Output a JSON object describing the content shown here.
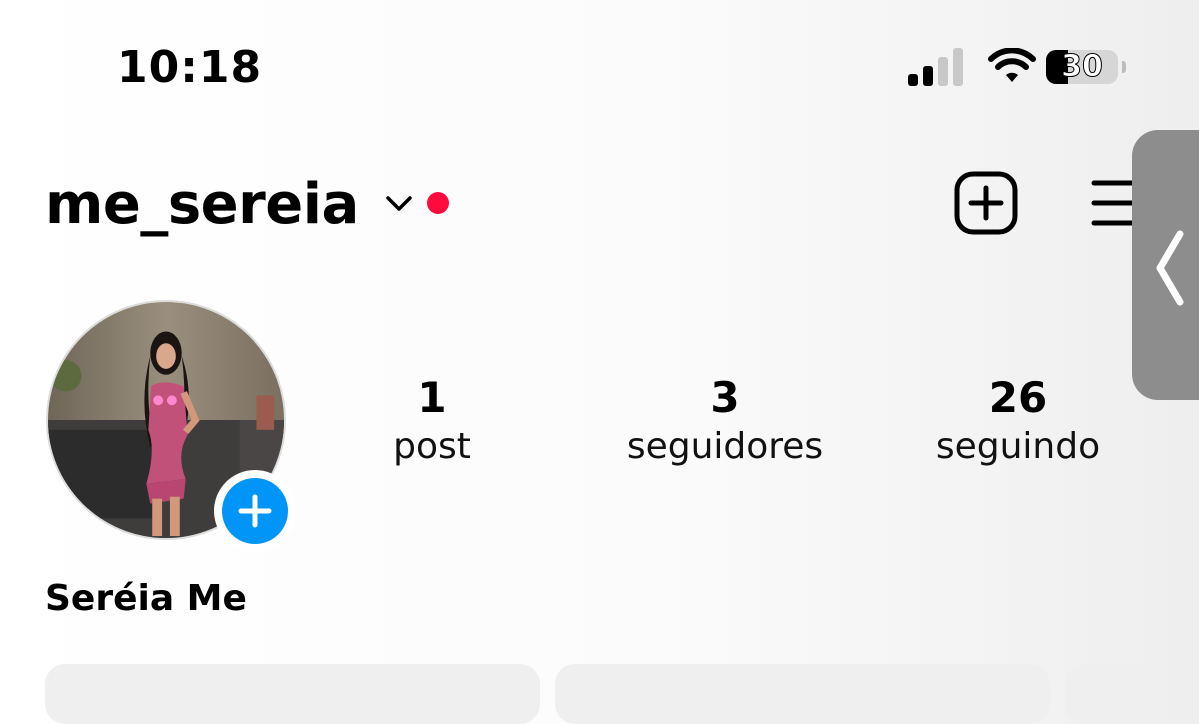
{
  "status_bar": {
    "time": "10:18",
    "battery_level": "30",
    "battery_fraction": 0.3
  },
  "header": {
    "username": "me_sereia",
    "live_indicator_color": "#ff0a3c",
    "icons": [
      "chevron-down-icon",
      "new-post-icon",
      "menu-icon"
    ]
  },
  "profile": {
    "display_name": "Seréia Me",
    "add_story_color": "#0095f6",
    "stats": [
      {
        "count": "1",
        "label": "post"
      },
      {
        "count": "3",
        "label": "seguidores"
      },
      {
        "count": "26",
        "label": "seguindo"
      }
    ]
  },
  "colors": {
    "accent_blue": "#0095f6",
    "button_bg": "#efefef",
    "side_handle": "#8d8d8d"
  }
}
